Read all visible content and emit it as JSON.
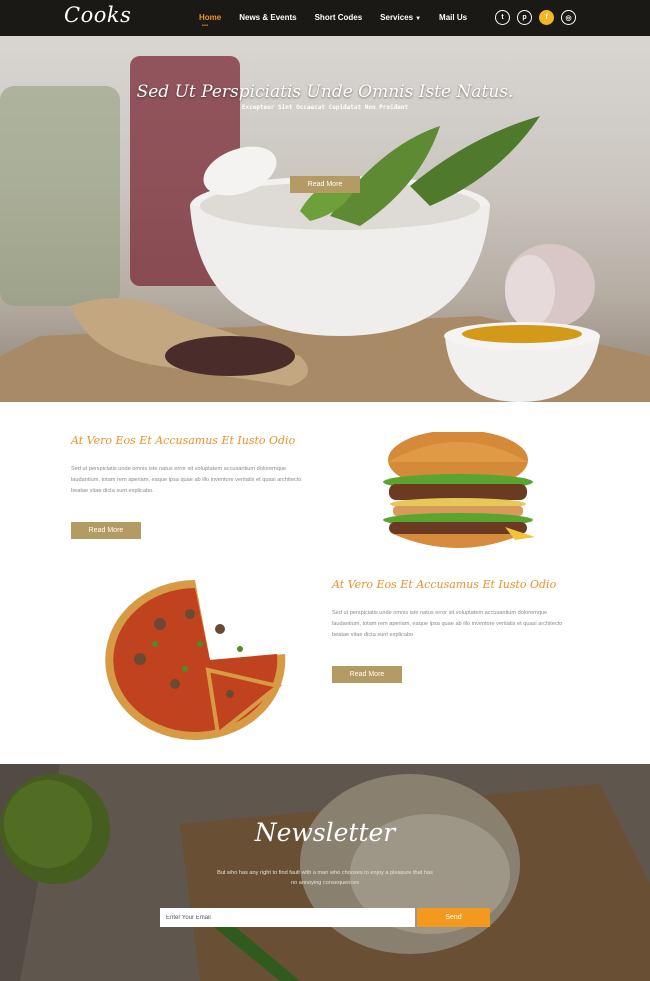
{
  "nav": {
    "logo": "Cooks",
    "items": [
      {
        "label": "Home",
        "active": true
      },
      {
        "label": "News & Events"
      },
      {
        "label": "Short Codes"
      },
      {
        "label": "Services",
        "dropdown": true
      },
      {
        "label": "Mail Us"
      }
    ],
    "socials": [
      {
        "icon": "twitter-icon",
        "glyph": "t"
      },
      {
        "icon": "pinterest-icon",
        "glyph": "p"
      },
      {
        "icon": "facebook-icon",
        "glyph": "f"
      },
      {
        "icon": "dribbble-icon",
        "glyph": "◎"
      }
    ]
  },
  "hero": {
    "title": "Sed Ut Perspiciatis Unde Omnis Iste Natus.",
    "subtitle": "Excepteur Sint Occaecat Cupidatat Non Proident",
    "button": "Read More"
  },
  "feature1": {
    "title": "At Vero Eos Et Accusamus Et Iusto Odio",
    "body": "Sed ut perspiciatis unde omnis iste natus error sit voluptatem accusantium doloremque laudantium, totam rem aperiam, eaque ipsa quae ab illo inventore veritatis et quasi architecto beatae vitae dicta sunt explicabo.",
    "button": "Read More"
  },
  "feature2": {
    "title": "At Vero Eos Et Accusamus Et Iusto Odio",
    "body": "Sed ut perspiciatis unde omnis iste natus error sit voluptatem accusantium doloremque laudantium, totam rem aperiam, eaque ipsa quae ab illo inventore veritatis et quasi architecto beatae vitae dicta sunt explicabo.",
    "button": "Read More"
  },
  "newsletter": {
    "title": "Newsletter",
    "text": "But who has any right to find fault with a man who chooses to enjoy a pleasure that has no annoying consequences",
    "placeholder": "Enter Your Email",
    "button": "Send"
  },
  "colors": {
    "accent": "#e8922c",
    "gold": "#b49a63",
    "send": "#f39a1e",
    "facebook": "#f5b623"
  }
}
